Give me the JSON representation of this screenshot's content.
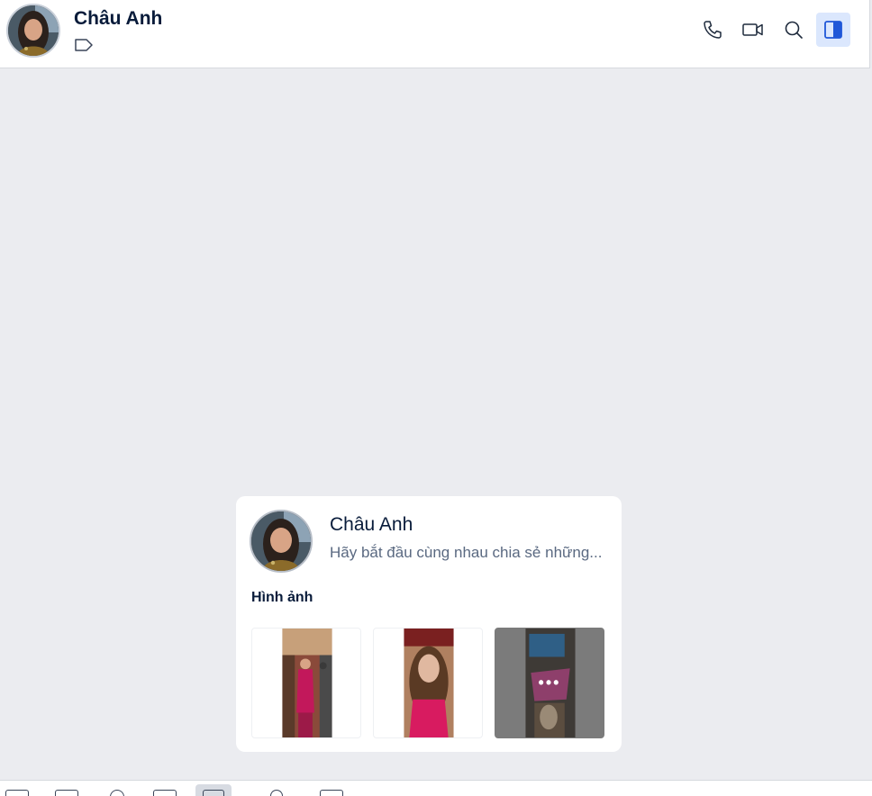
{
  "header": {
    "title": "Châu Anh",
    "avatar_icon": "contact-avatar-photo",
    "tag_icon": "label-tag-icon",
    "actions": [
      {
        "name": "phone-call-icon"
      },
      {
        "name": "video-call-icon"
      },
      {
        "name": "search-icon"
      },
      {
        "name": "sidebar-toggle-icon",
        "active": true
      }
    ]
  },
  "card": {
    "name": "Châu Anh",
    "status": "Hãy bắt đầu cùng nhau chia sẻ những...",
    "section_title": "Hình ảnh",
    "more_label": "•••"
  },
  "colors": {
    "accent": "#2563eb",
    "active_bg": "#dbe7fd",
    "text_primary": "#081b3a",
    "text_secondary": "#5a6981",
    "chat_bg": "#ebecf0"
  },
  "toolbar": {
    "icons": [
      "sticker-icon",
      "image-icon",
      "attachment-icon",
      "card-icon",
      "screenshot-icon",
      "text-format-icon",
      "more-icon"
    ]
  }
}
